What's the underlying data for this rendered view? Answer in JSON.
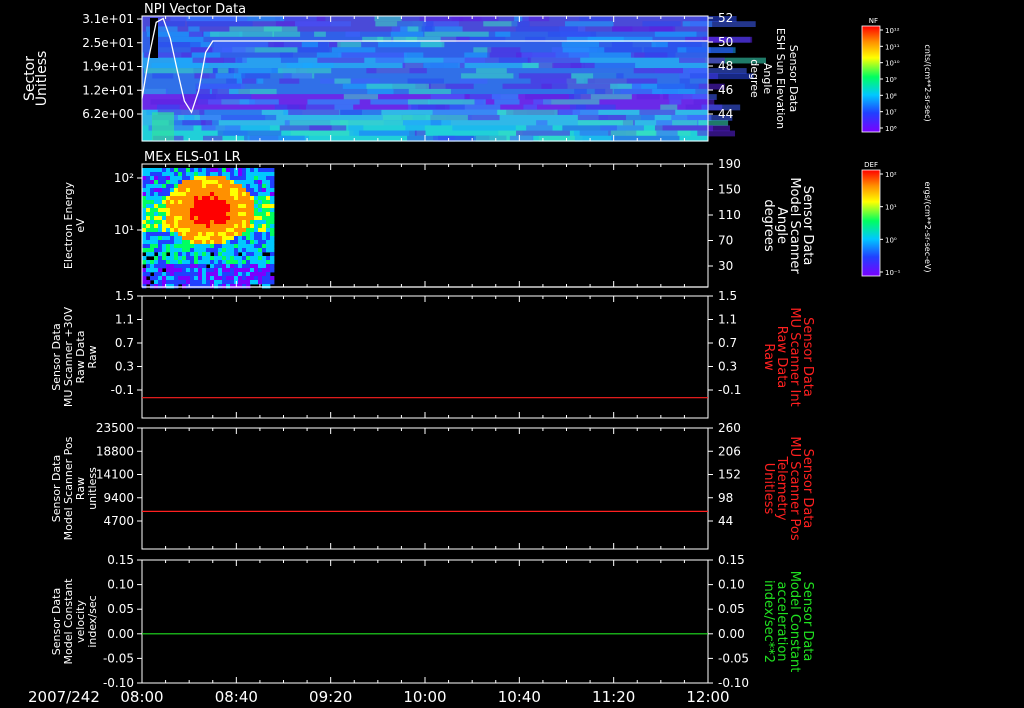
{
  "colors": {
    "background": "#000000",
    "axis": "#ffffff",
    "red": "#ff2020",
    "green": "#20e020"
  },
  "time_axis": {
    "date_label": "2007/242",
    "ticks": [
      "08:00",
      "08:40",
      "09:20",
      "10:00",
      "10:40",
      "11:20",
      "12:00"
    ]
  },
  "colorbars": [
    {
      "label": "NF",
      "unit": "cnts/(cm**2-sr-sec)",
      "ticks": [
        "10¹²",
        "10¹¹",
        "10¹⁰",
        "10⁹",
        "10⁸",
        "10⁷",
        "10⁶"
      ]
    },
    {
      "label": "DEF",
      "unit": "ergs/(cm**2-sr-sec-eV)",
      "ticks": [
        "10²",
        "10¹",
        "10⁰",
        "10⁻¹"
      ]
    }
  ],
  "chart_data": [
    {
      "type": "heatmap",
      "title": "NPI Vector Data",
      "ylabel": [
        "Sector",
        "Unitless"
      ],
      "yticks": [
        "3.1e+01",
        "2.5e+01",
        "1.9e+01",
        "1.2e+01",
        "6.2e+00"
      ],
      "y2label": [
        "Sensor Data",
        "ESH Sun Elevation",
        "Angle",
        "degree"
      ],
      "y2ticks": [
        "52",
        "50",
        "48",
        "46",
        "44"
      ],
      "y2lim": [
        42,
        52
      ],
      "overlay_line": {
        "color": "#ffffff",
        "x": [
          "08:00",
          "08:03",
          "08:06",
          "08:09",
          "08:12",
          "08:15",
          "08:18",
          "08:21",
          "08:24",
          "08:27",
          "08:30",
          "12:00"
        ],
        "y": [
          45.4,
          48.8,
          51.5,
          51.8,
          50.2,
          47.6,
          45.2,
          44.3,
          46.0,
          49.1,
          50.0,
          50.0
        ]
      }
    },
    {
      "type": "heatmap",
      "title": "MEx ELS-01 LR",
      "ylabel": [
        "Electron Energy",
        "eV"
      ],
      "yticks": [
        "10²",
        "10¹"
      ],
      "yscale": "log",
      "data_end": "08:55",
      "y2label": [
        "Sensor Data",
        "Model Scanner",
        "Angle",
        "degrees"
      ],
      "y2ticks": [
        "190",
        "150",
        "110",
        "70",
        "30"
      ],
      "y2lim": [
        10,
        190
      ],
      "overlay_line": {
        "color": "#ffffff",
        "x": [
          "08:00",
          "12:00"
        ],
        "y": [
          10,
          10
        ]
      }
    },
    {
      "type": "line",
      "ylabel": [
        "Sensor Data",
        "MU Scanner +30V",
        "Raw Data",
        "Raw"
      ],
      "yticks": [
        "1.5",
        "1.1",
        "0.7",
        "0.3",
        "-0.1"
      ],
      "ylim": [
        -0.3,
        1.5
      ],
      "y2label": [
        "Sensor Data",
        "MU Scanner Int",
        "Raw Data",
        "Raw"
      ],
      "y2ticks": [
        "1.5",
        "1.1",
        "0.7",
        "0.3",
        "-0.1"
      ],
      "y2_color": "#ff2020",
      "series": [
        {
          "color": "#ff2020",
          "x": [
            "08:00",
            "12:00"
          ],
          "values": [
            0.0,
            0.0
          ]
        }
      ]
    },
    {
      "type": "line",
      "ylabel": [
        "Sensor Data",
        "Model Scanner Pos",
        "Raw",
        "unitless"
      ],
      "yticks": [
        "23500",
        "18800",
        "14100",
        "9400",
        "4700"
      ],
      "ylim": [
        0,
        23500
      ],
      "y2label": [
        "Sensor Data",
        "MU Scanner Pos",
        "Telemetry",
        "Unitless"
      ],
      "y2ticks": [
        "260",
        "206",
        "152",
        "98",
        "44"
      ],
      "y2_color": "#ff2020",
      "series": [
        {
          "color": "#ff2020",
          "x": [
            "08:00",
            "12:00"
          ],
          "values": [
            7300,
            7300
          ]
        }
      ]
    },
    {
      "type": "line",
      "ylabel": [
        "Sensor Data",
        "Model Constant",
        "velocity",
        "index/sec"
      ],
      "yticks": [
        "0.15",
        "0.10",
        "0.05",
        "0.00",
        "-0.05",
        "-0.10"
      ],
      "ylim": [
        -0.1,
        0.15
      ],
      "y2label": [
        "Sensor Data",
        "Model Constant",
        "acceleration",
        "index/sec**2"
      ],
      "y2ticks": [
        "0.15",
        "0.10",
        "0.05",
        "0.00",
        "-0.05",
        "-0.10"
      ],
      "y2_color": "#20e020",
      "series": [
        {
          "color": "#20e020",
          "x": [
            "08:00",
            "12:00"
          ],
          "values": [
            0.0,
            0.0
          ]
        }
      ]
    }
  ]
}
